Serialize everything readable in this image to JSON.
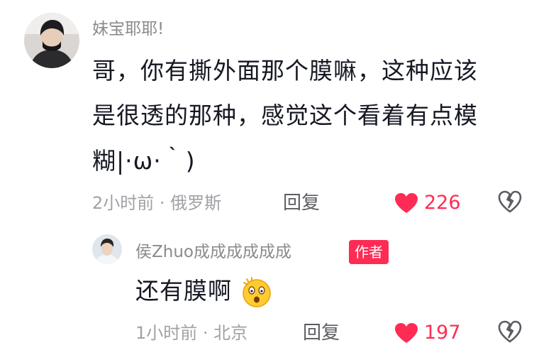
{
  "comment": {
    "username": "妹宝耶耶!",
    "text_lines": [
      "哥，你有撕外面那个膜嘛，这种应该",
      "是很透的那种，感觉这个看着有点模",
      "糊|·ω·｀)"
    ],
    "time": "2小时前",
    "location": "俄罗斯",
    "meta_sep": " · ",
    "reply_label": "回复",
    "like_count": "226"
  },
  "reply": {
    "username": "侯Zhuo成成成成成成",
    "author_badge": "作者",
    "text": "还有膜啊",
    "emoji": "shocked-face-emoji",
    "time": "1小时前",
    "location": "北京",
    "meta_sep": " · ",
    "reply_label": "回复",
    "like_count": "197"
  },
  "colors": {
    "accent": "#fe2c55",
    "text_primary": "#161823",
    "text_secondary": "#8a8a8f"
  },
  "icons": [
    "heart-icon",
    "dislike-icon"
  ]
}
